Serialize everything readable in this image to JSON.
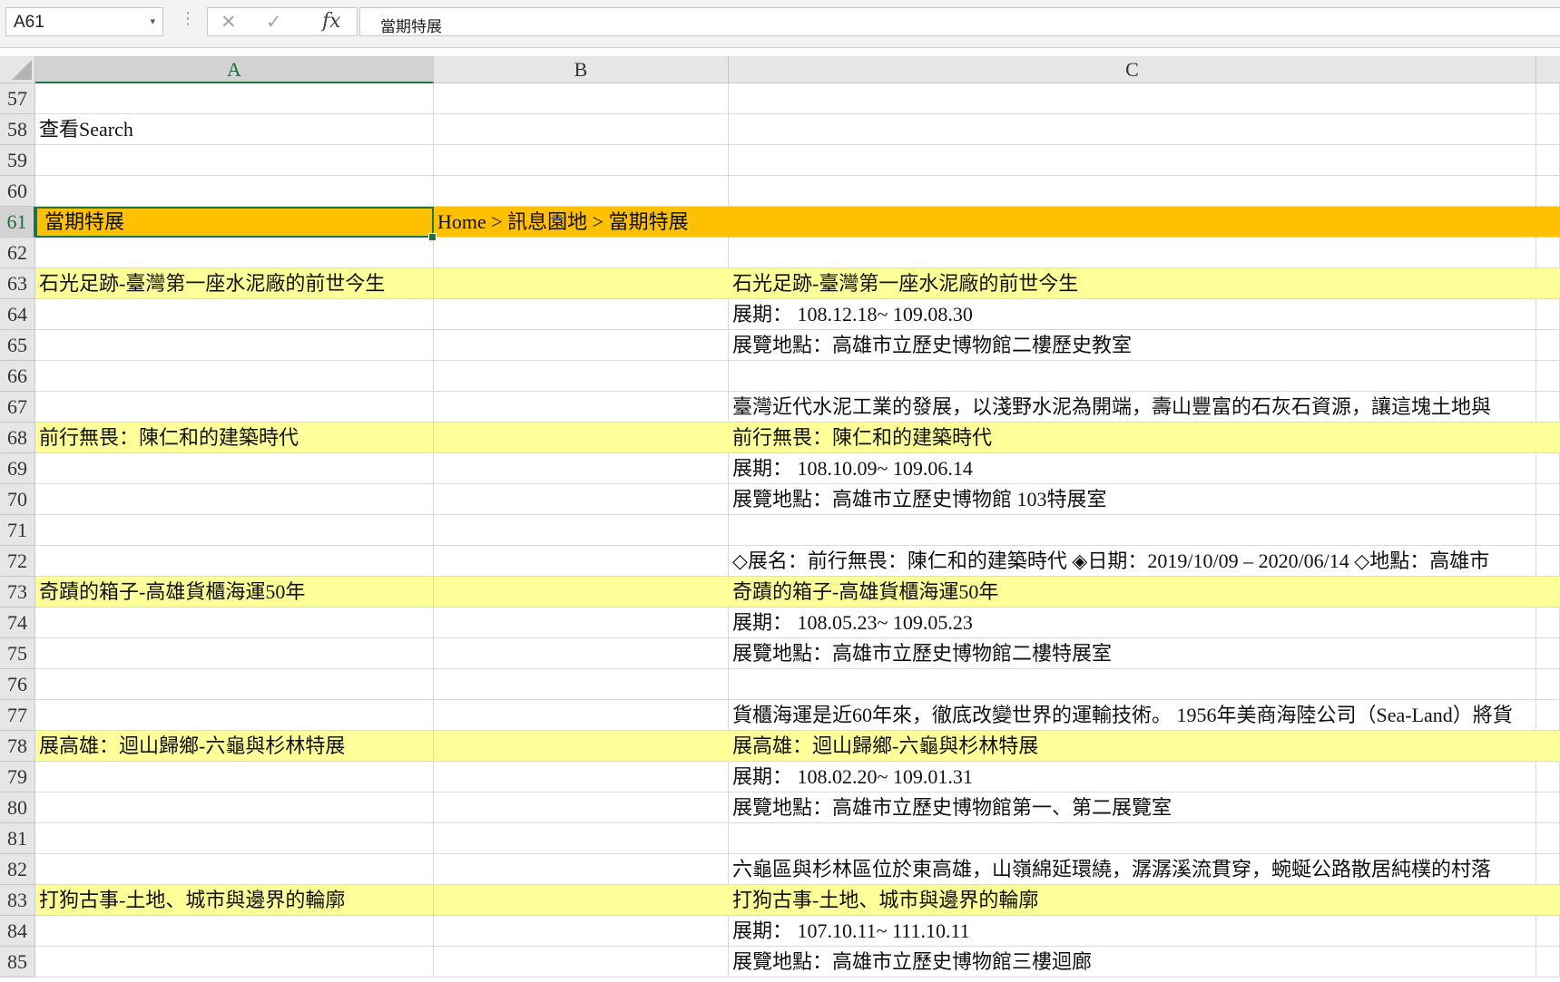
{
  "formula_bar": {
    "name_box": "A61",
    "name_box_arrow": "▾",
    "grip": "⋮",
    "cancel_glyph": "✕",
    "enter_glyph": "✓",
    "fx_label": "fx",
    "formula": "當期特展"
  },
  "columns": [
    {
      "label": "A",
      "selected": true
    },
    {
      "label": "B",
      "selected": false
    },
    {
      "label": "C",
      "selected": false
    }
  ],
  "rows": [
    {
      "num": "57",
      "a": "",
      "b": "",
      "c": "",
      "style": "plain"
    },
    {
      "num": "58",
      "a": "查看Search",
      "b": "",
      "c": "",
      "style": "plain"
    },
    {
      "num": "59",
      "a": "",
      "b": "",
      "c": "",
      "style": "plain"
    },
    {
      "num": "60",
      "a": "",
      "b": "",
      "c": "",
      "style": "plain"
    },
    {
      "num": "61",
      "a": "當期特展",
      "b": "Home > 訊息園地 > 當期特展",
      "c": "",
      "style": "orange"
    },
    {
      "num": "62",
      "a": "",
      "b": "",
      "c": "",
      "style": "plain"
    },
    {
      "num": "63",
      "a": "石光足跡-臺灣第一座水泥廠的前世今生",
      "b": "",
      "c": "石光足跡-臺灣第一座水泥廠的前世今生",
      "style": "band"
    },
    {
      "num": "64",
      "a": "",
      "b": "",
      "c": "展期： 108.12.18~ 109.08.30",
      "style": "plain"
    },
    {
      "num": "65",
      "a": "",
      "b": "",
      "c": "展覽地點：高雄市立歷史博物館二樓歷史教室",
      "style": "plain"
    },
    {
      "num": "66",
      "a": "",
      "b": "",
      "c": "",
      "style": "plain"
    },
    {
      "num": "67",
      "a": "",
      "b": "",
      "c": "臺灣近代水泥工業的發展，以淺野水泥為開端，壽山豐富的石灰石資源，讓這塊土地與",
      "style": "plain"
    },
    {
      "num": "68",
      "a": "前行無畏：陳仁和的建築時代",
      "b": "",
      "c": "前行無畏：陳仁和的建築時代",
      "style": "band"
    },
    {
      "num": "69",
      "a": "",
      "b": "",
      "c": "展期： 108.10.09~ 109.06.14",
      "style": "plain"
    },
    {
      "num": "70",
      "a": "",
      "b": "",
      "c": "展覽地點：高雄市立歷史博物館 103特展室",
      "style": "plain"
    },
    {
      "num": "71",
      "a": "",
      "b": "",
      "c": "",
      "style": "plain"
    },
    {
      "num": "72",
      "a": "",
      "b": "",
      "c": "◇展名：前行無畏：陳仁和的建築時代 ◈日期：2019/10/09 – 2020/06/14 ◇地點：高雄市",
      "style": "plain"
    },
    {
      "num": "73",
      "a": "奇蹟的箱子-高雄貨櫃海運50年",
      "b": "",
      "c": "奇蹟的箱子-高雄貨櫃海運50年",
      "style": "band"
    },
    {
      "num": "74",
      "a": "",
      "b": "",
      "c": "展期： 108.05.23~ 109.05.23",
      "style": "plain"
    },
    {
      "num": "75",
      "a": "",
      "b": "",
      "c": "展覽地點：高雄市立歷史博物館二樓特展室",
      "style": "plain"
    },
    {
      "num": "76",
      "a": "",
      "b": "",
      "c": "",
      "style": "plain"
    },
    {
      "num": "77",
      "a": "",
      "b": "",
      "c": "貨櫃海運是近60年來，徹底改變世界的運輸技術。 1956年美商海陸公司（Sea-Land）將貨",
      "style": "plain"
    },
    {
      "num": "78",
      "a": "展高雄：迴山歸鄉-六龜與杉林特展",
      "b": "",
      "c": "展高雄：迴山歸鄉-六龜與杉林特展",
      "style": "band"
    },
    {
      "num": "79",
      "a": "",
      "b": "",
      "c": "展期： 108.02.20~ 109.01.31",
      "style": "plain"
    },
    {
      "num": "80",
      "a": "",
      "b": "",
      "c": "展覽地點：高雄市立歷史博物館第一、第二展覽室",
      "style": "plain"
    },
    {
      "num": "81",
      "a": "",
      "b": "",
      "c": "",
      "style": "plain"
    },
    {
      "num": "82",
      "a": "",
      "b": "",
      "c": "六龜區與杉林區位於東高雄，山嶺綿延環繞，潺潺溪流貫穿，蜿蜒公路散居純樸的村落",
      "style": "plain"
    },
    {
      "num": "83",
      "a": "打狗古事-土地、城市與邊界的輪廓",
      "b": "",
      "c": "打狗古事-土地、城市與邊界的輪廓",
      "style": "band"
    },
    {
      "num": "84",
      "a": "",
      "b": "",
      "c": "展期： 107.10.11~ 111.10.11",
      "style": "plain"
    },
    {
      "num": "85",
      "a": "",
      "b": "",
      "c": "展覽地點：高雄市立歷史博物館三樓迴廊",
      "style": "plain"
    }
  ],
  "active_cell": {
    "row": "61",
    "col": "A"
  },
  "colors": {
    "band": "#ffff99",
    "header_orange": "#ffc000",
    "selection_green": "#217346"
  }
}
